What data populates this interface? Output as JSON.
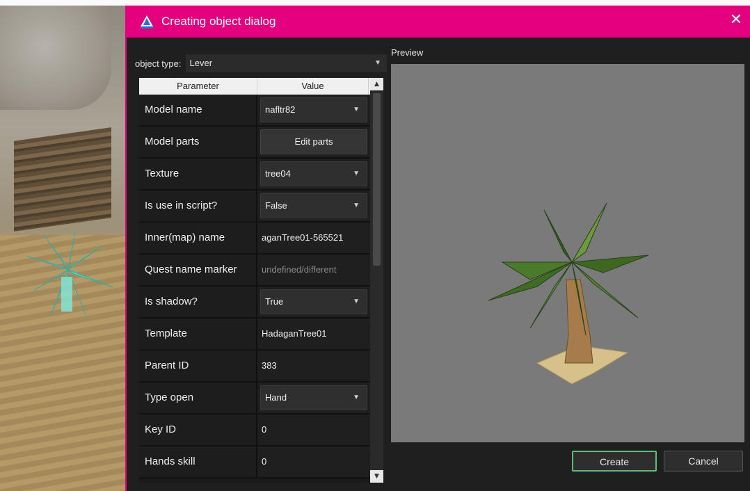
{
  "window": {
    "title": "Creating object dialog",
    "accent_color": "#e3007e"
  },
  "object_type": {
    "label": "object type:",
    "value": "Lever"
  },
  "table": {
    "headers": [
      "Parameter",
      "Value"
    ],
    "rows": [
      {
        "param": "Model name",
        "value": "nafltr82",
        "kind": "dropdown"
      },
      {
        "param": "Model parts",
        "value": "Edit parts",
        "kind": "button"
      },
      {
        "param": "Texture",
        "value": "tree04",
        "kind": "dropdown"
      },
      {
        "param": "Is use in script?",
        "value": "False",
        "kind": "dropdown"
      },
      {
        "param": "Inner(map) name",
        "value": "aganTree01-565521",
        "kind": "text"
      },
      {
        "param": "Quest name marker",
        "value": "undefined/different",
        "kind": "placeholder"
      },
      {
        "param": "Is shadow?",
        "value": "True",
        "kind": "dropdown"
      },
      {
        "param": "Template",
        "value": "HadaganTree01",
        "kind": "text"
      },
      {
        "param": "Parent ID",
        "value": "383",
        "kind": "text"
      },
      {
        "param": "Type open",
        "value": "Hand",
        "kind": "dropdown"
      },
      {
        "param": "Key ID",
        "value": "0",
        "kind": "text"
      },
      {
        "param": "Hands skill",
        "value": "0",
        "kind": "text"
      }
    ]
  },
  "preview": {
    "label": "Preview",
    "background": "#7a7a7a"
  },
  "buttons": {
    "create": "Create",
    "cancel": "Cancel"
  },
  "icons": {
    "close": "close-icon",
    "dropdown": "chevron-down-icon",
    "app": "app-logo-icon"
  }
}
